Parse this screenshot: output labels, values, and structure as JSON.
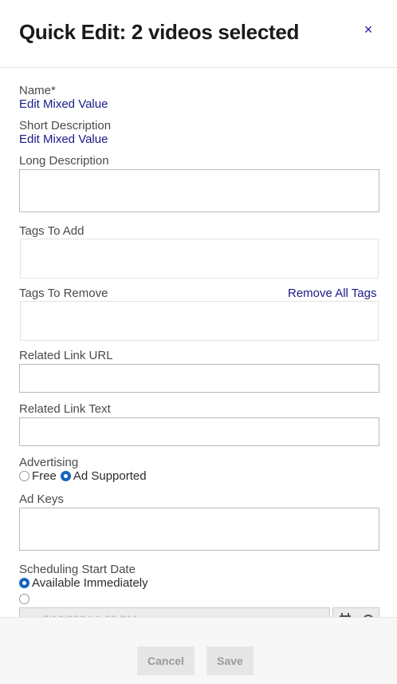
{
  "header": {
    "title": "Quick Edit: 2 videos selected",
    "close_icon": "×"
  },
  "form": {
    "name_label": "Name*",
    "name_link": "Edit Mixed Value",
    "short_desc_label": "Short Description",
    "short_desc_link": "Edit Mixed Value",
    "long_desc_label": "Long Description",
    "long_desc_value": "",
    "tags_add_label": "Tags To Add",
    "tags_remove_label": "Tags To Remove",
    "remove_all_tags": "Remove All Tags",
    "related_url_label": "Related Link URL",
    "related_url_value": "",
    "related_text_label": "Related Link Text",
    "related_text_value": "",
    "advertising_label": "Advertising",
    "advertising_options": [
      "Free",
      "Ad Supported"
    ],
    "advertising_selected": "Ad Supported",
    "ad_keys_label": "Ad Keys",
    "ad_keys_value": "",
    "schedule_label": "Scheduling Start Date",
    "schedule_option_1": "Available Immediately",
    "schedule_option_1_selected": true,
    "schedule_option_2": "",
    "schedule_date_value": "7/10/2024 1:00 PM"
  },
  "footer": {
    "cancel_label": "Cancel",
    "save_label": "Save"
  },
  "colors": {
    "link": "#1a1a8a",
    "radio_active": "#1565c0",
    "button_bg": "#e6e6e6",
    "button_text": "#9a9a9a"
  },
  "icons": [
    "close-icon",
    "calendar-icon",
    "clock-icon",
    "resize-handle-icon"
  ]
}
